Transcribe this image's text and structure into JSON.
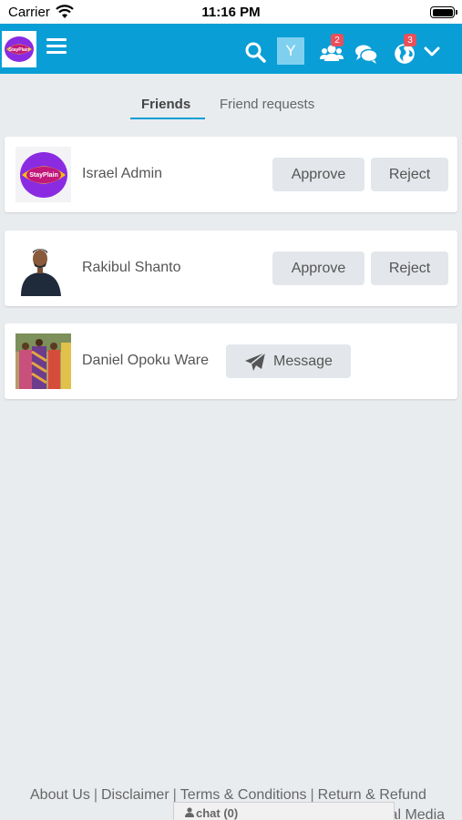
{
  "status": {
    "carrier": "Carrier",
    "time": "11:16 PM"
  },
  "nav": {
    "logo_text": "StayPlain",
    "avatar_letter": "Y",
    "friend_badge": "2",
    "notif_badge": "3"
  },
  "tabs": [
    {
      "label": "Friends",
      "active": true
    },
    {
      "label": "Friend requests",
      "active": false
    }
  ],
  "friends": [
    {
      "name": "Israel Admin",
      "approve": "Approve",
      "reject": "Reject"
    },
    {
      "name": "Rakibul Shanto",
      "approve": "Approve",
      "reject": "Reject"
    },
    {
      "name": "Daniel Opoku Ware",
      "message": "Message"
    }
  ],
  "footer": {
    "links": [
      "About Us",
      "Disclaimer",
      "Terms & Conditions",
      "Return & Refund"
    ],
    "line2": "ial Media",
    "chat": "chat (0)"
  },
  "colors": {
    "accent": "#0a9ed6",
    "badge": "#e8505b",
    "button": "#e3e6ea"
  }
}
